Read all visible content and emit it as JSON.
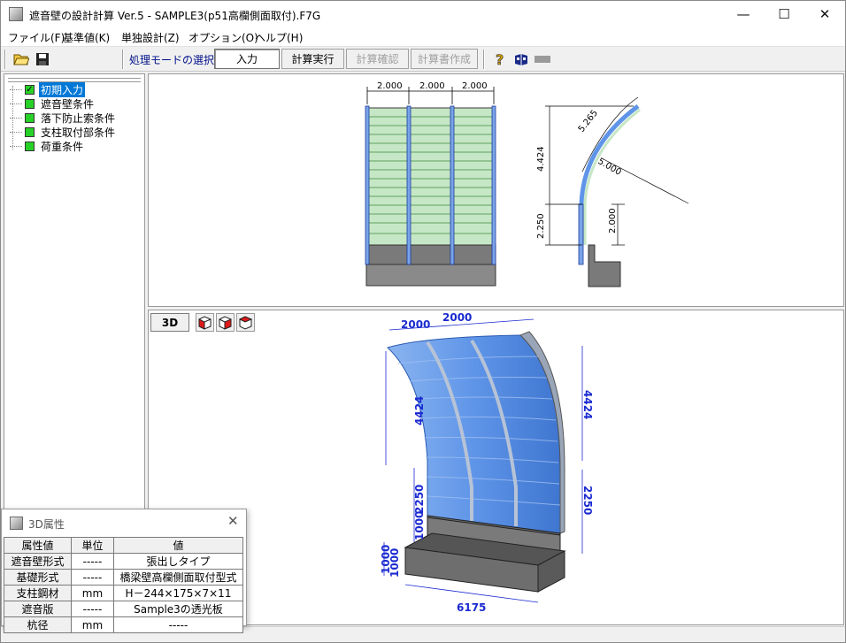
{
  "window": {
    "title": "遮音壁の設計計算 Ver.5 - SAMPLE3(p51高欄側面取付).F7G",
    "minimize_glyph": "—",
    "maximize_glyph": "☐",
    "close_glyph": "✕"
  },
  "menu": [
    "ファイル(F)",
    "基準値(K)",
    "単独設計(Z)",
    "オプション(O)",
    "ヘルプ(H)"
  ],
  "toolbar": {
    "mode_label": "処理モードの選択",
    "buttons": [
      "入力",
      "計算実行",
      "計算確認",
      "計算書作成"
    ],
    "icons": [
      "open-folder-icon",
      "save-disk-icon",
      "help-icon",
      "book-icon",
      "gray-bar-icon"
    ]
  },
  "tree": {
    "items": [
      {
        "label": "初期入力",
        "checked": true,
        "selected": true
      },
      {
        "label": "遮音壁条件",
        "checked": false
      },
      {
        "label": "落下防止索条件",
        "checked": false
      },
      {
        "label": "支柱取付部条件",
        "checked": false
      },
      {
        "label": "荷重条件",
        "checked": false
      }
    ]
  },
  "drawing_2d": {
    "front_dims": [
      "2.000",
      "2.000",
      "2.000"
    ],
    "side_dims": {
      "arc": "5.265",
      "radius": "5.000",
      "height_upper": "4.424",
      "height_lower": "2.250",
      "height_right": "2.000"
    }
  },
  "view_3d": {
    "button_label": "3D",
    "dims": {
      "top1": "2000",
      "top2": "2000",
      "left_upper": "4424",
      "left_mid": "2250",
      "left_base": "1000",
      "left_low1": "1000",
      "left_low2": "1000",
      "right_upper": "4424",
      "right_lower": "2250",
      "bottom": "6175"
    }
  },
  "attr_window": {
    "title": "3D属性",
    "headers": [
      "属性値",
      "単位",
      "値"
    ],
    "rows": [
      {
        "name": "遮音壁形式",
        "unit": "-----",
        "value": "張出しタイプ"
      },
      {
        "name": "基礎形式",
        "unit": "-----",
        "value": "橋梁壁高欄側面取付型式"
      },
      {
        "name": "支柱鋼材",
        "unit": "mm",
        "value": "H－244×175×7×11"
      },
      {
        "name": "遮音版",
        "unit": "-----",
        "value": "Sample3の透光板"
      },
      {
        "name": "杭径",
        "unit": "mm",
        "value": "-----"
      }
    ]
  },
  "colors": {
    "accent": "#0078d7",
    "panel_green": "#c6e7c6",
    "post_blue": "#7aa4e8",
    "concrete": "#7a7a7a",
    "wall_blue": "#5f95e8"
  }
}
